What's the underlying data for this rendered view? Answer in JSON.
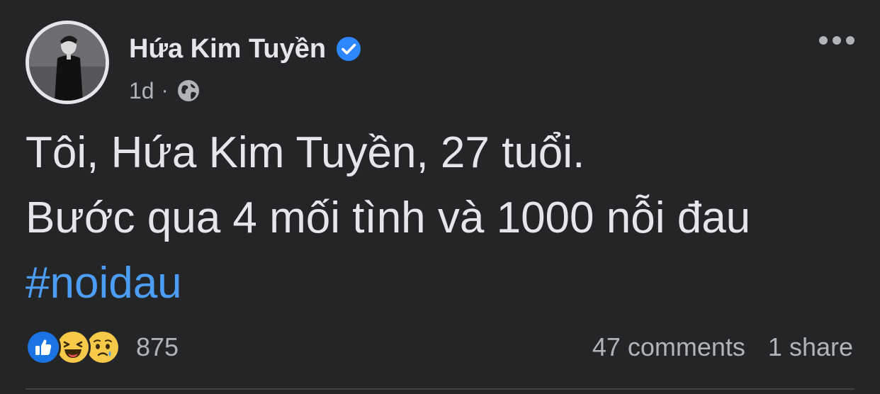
{
  "post": {
    "author": {
      "name": "Hứa Kim Tuyền",
      "verified": true,
      "avatar_icon": "profile-photo"
    },
    "meta": {
      "time": "1d",
      "separator": "·",
      "audience_icon": "globe-icon"
    },
    "content": {
      "line1": "Tôi, Hứa Kim Tuyền, 27 tuổi.",
      "line2": "Bước qua 4 mối tình và 1000 nỗi đau",
      "hashtag": "#noidau"
    },
    "reactions": {
      "types": [
        "like",
        "haha",
        "sad"
      ],
      "count": "875"
    },
    "stats": {
      "comments": "47 comments",
      "shares": "1 share"
    },
    "colors": {
      "background": "#242526",
      "text": "#e4e6eb",
      "secondary_text": "#b0b3b8",
      "hashtag": "#4b9df5",
      "verified_badge": "#2d88ff"
    }
  }
}
